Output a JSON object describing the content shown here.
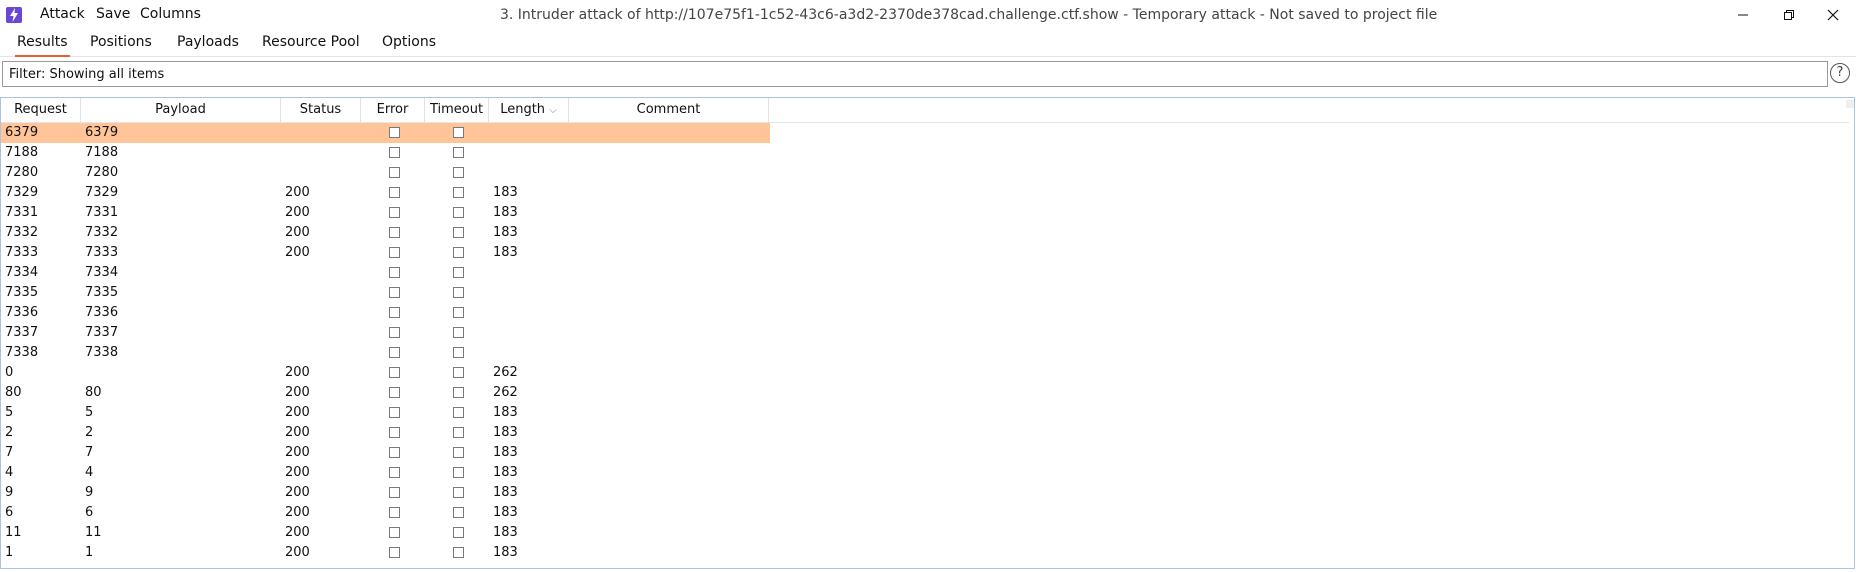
{
  "menu": {
    "attack": "Attack",
    "save": "Save",
    "columns": "Columns"
  },
  "window_title": "3. Intruder attack of http://107e75f1-1c52-43c6-a3d2-2370de378cad.challenge.ctf.show - Temporary attack - Not saved to project file",
  "tabs": [
    "Results",
    "Positions",
    "Payloads",
    "Resource Pool",
    "Options"
  ],
  "active_tab": "Results",
  "filter": {
    "text": "Filter: Showing all items"
  },
  "help_glyph": "?",
  "table": {
    "columns": [
      "Request",
      "Payload",
      "Status",
      "Error",
      "Timeout",
      "Length",
      "Comment"
    ],
    "sort_indicator": "⌵",
    "rows": [
      {
        "request": "6379",
        "payload": "6379",
        "status": "",
        "length": "",
        "selected": true
      },
      {
        "request": "7188",
        "payload": "7188",
        "status": "",
        "length": ""
      },
      {
        "request": "7280",
        "payload": "7280",
        "status": "",
        "length": ""
      },
      {
        "request": "7329",
        "payload": "7329",
        "status": "200",
        "length": "183"
      },
      {
        "request": "7331",
        "payload": "7331",
        "status": "200",
        "length": "183"
      },
      {
        "request": "7332",
        "payload": "7332",
        "status": "200",
        "length": "183"
      },
      {
        "request": "7333",
        "payload": "7333",
        "status": "200",
        "length": "183"
      },
      {
        "request": "7334",
        "payload": "7334",
        "status": "",
        "length": ""
      },
      {
        "request": "7335",
        "payload": "7335",
        "status": "",
        "length": ""
      },
      {
        "request": "7336",
        "payload": "7336",
        "status": "",
        "length": ""
      },
      {
        "request": "7337",
        "payload": "7337",
        "status": "",
        "length": ""
      },
      {
        "request": "7338",
        "payload": "7338",
        "status": "",
        "length": ""
      },
      {
        "request": "0",
        "payload": "",
        "status": "200",
        "length": "262"
      },
      {
        "request": "80",
        "payload": "80",
        "status": "200",
        "length": "262"
      },
      {
        "request": "5",
        "payload": "5",
        "status": "200",
        "length": "183"
      },
      {
        "request": "2",
        "payload": "2",
        "status": "200",
        "length": "183"
      },
      {
        "request": "7",
        "payload": "7",
        "status": "200",
        "length": "183"
      },
      {
        "request": "4",
        "payload": "4",
        "status": "200",
        "length": "183"
      },
      {
        "request": "9",
        "payload": "9",
        "status": "200",
        "length": "183"
      },
      {
        "request": "6",
        "payload": "6",
        "status": "200",
        "length": "183"
      },
      {
        "request": "11",
        "payload": "11",
        "status": "200",
        "length": "183"
      },
      {
        "request": "1",
        "payload": "1",
        "status": "200",
        "length": "183"
      }
    ]
  },
  "colors": {
    "accent": "#e8602c",
    "selected_row": "#ffc599",
    "app_icon": "#6b47d6"
  }
}
